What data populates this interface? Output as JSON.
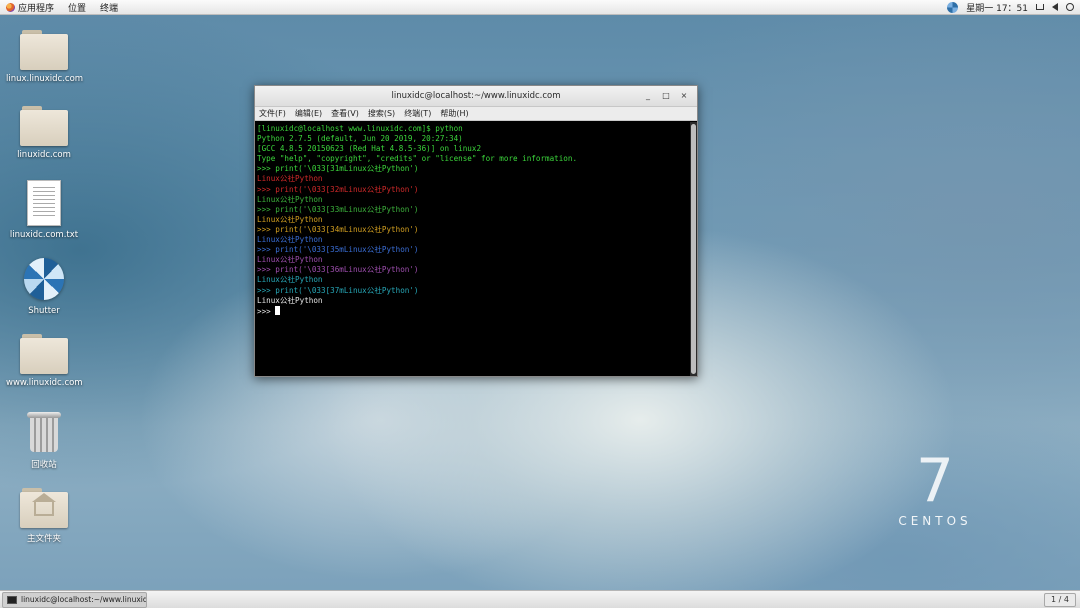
{
  "topbar": {
    "apps_label": "应用程序",
    "places_label": "位置",
    "terminal_label": "终端",
    "clock": "星期一 17：51",
    "icons": [
      "shutter-tray-icon",
      "network-icon",
      "volume-icon",
      "power-icon",
      "chevron-down-icon"
    ]
  },
  "desktop": {
    "icons": [
      {
        "label": "linux.linuxidc.com",
        "type": "folder"
      },
      {
        "label": "linuxidc.com",
        "type": "folder"
      },
      {
        "label": "linuxidc.com.txt",
        "type": "text-file"
      },
      {
        "label": "Shutter",
        "type": "app"
      },
      {
        "label": "www.linuxidc.com",
        "type": "folder"
      },
      {
        "label": "回收站",
        "type": "trash"
      },
      {
        "label": "主文件夹",
        "type": "home-folder"
      }
    ]
  },
  "window": {
    "title": "linuxidc@localhost:~/www.linuxidc.com",
    "buttons": {
      "minimize": "_",
      "maximize": "□",
      "close": "×"
    },
    "menu": [
      "文件(F)",
      "编辑(E)",
      "查看(V)",
      "搜索(S)",
      "终端(T)",
      "帮助(H)"
    ]
  },
  "terminal": {
    "lines": [
      {
        "text": "[linuxidc@localhost www.linuxidc.com]$ python",
        "color": "#3cd73c"
      },
      {
        "text": "Python 2.7.5 (default, Jun 20 2019, 20:27:34)",
        "color": "#3cd73c"
      },
      {
        "text": "[GCC 4.8.5 20150623 (Red Hat 4.8.5-36)] on linux2",
        "color": "#3cd73c"
      },
      {
        "text": "Type \"help\", \"copyright\", \"credits\" or \"license\" for more information.",
        "color": "#3cd73c"
      },
      {
        "text": ">>> print('\\033[31mLinux公社Python')",
        "color": "#3cd73c"
      },
      {
        "text": "Linux公社Python",
        "color": "#d12a2a"
      },
      {
        "text": ">>> print('\\033[32mLinux公社Python')",
        "color": "#d12a2a"
      },
      {
        "text": "Linux公社Python",
        "color": "#3cb33c"
      },
      {
        "text": ">>> print('\\033[33mLinux公社Python')",
        "color": "#3cb33c"
      },
      {
        "text": "Linux公社Python",
        "color": "#d4a020"
      },
      {
        "text": ">>> print('\\033[34mLinux公社Python')",
        "color": "#d4a020"
      },
      {
        "text": "Linux公社Python",
        "color": "#3a6fd8"
      },
      {
        "text": ">>> print('\\033[35mLinux公社Python')",
        "color": "#3a6fd8"
      },
      {
        "text": "Linux公社Python",
        "color": "#a04fb0"
      },
      {
        "text": ">>> print('\\033[36mLinux公社Python')",
        "color": "#a04fb0"
      },
      {
        "text": "Linux公社Python",
        "color": "#27a8b8"
      },
      {
        "text": ">>> print('\\033[37mLinux公社Python')",
        "color": "#27a8b8"
      },
      {
        "text": "Linux公社Python",
        "color": "#e6e6e6"
      },
      {
        "text": ">>> ",
        "color": "#e6e6e6"
      }
    ]
  },
  "branding": {
    "version": "7",
    "name": "CENTOS"
  },
  "taskbar": {
    "item_label": "linuxidc@localhost:~/www.linuxidc.c···",
    "workspace": "1 / 4"
  }
}
